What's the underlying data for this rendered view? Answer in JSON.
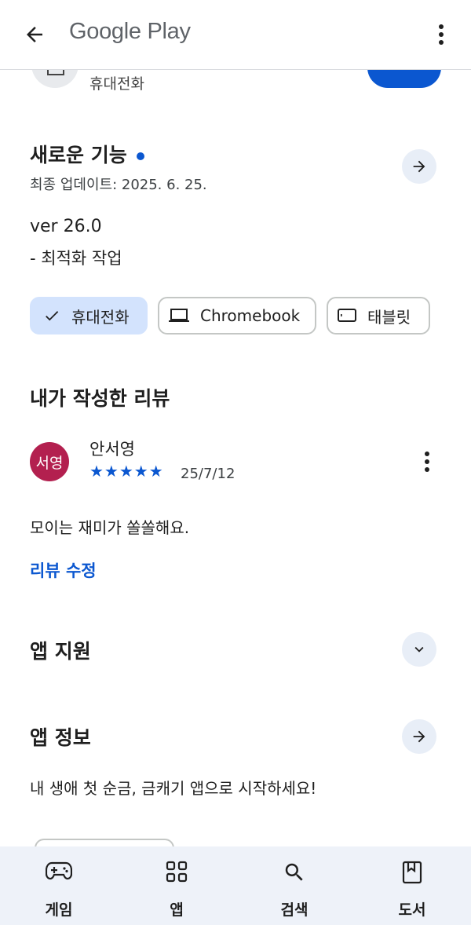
{
  "app_bar": {
    "title": "Google Play"
  },
  "device_row": {
    "label": "휴대전화"
  },
  "whats_new": {
    "title": "새로운 기능",
    "updated": "최종 업데이트: 2025. 6. 25.",
    "version": "ver 26.0",
    "changes": "- 최적화 작업"
  },
  "device_chips": [
    {
      "label": "휴대전화",
      "icon": "check-icon",
      "selected": true
    },
    {
      "label": "Chromebook",
      "icon": "laptop-icon",
      "selected": false
    },
    {
      "label": "태블릿",
      "icon": "tablet-icon",
      "selected": false
    }
  ],
  "my_review": {
    "title": "내가 작성한 리뷰",
    "avatar_text": "서영",
    "reviewer": "안서영",
    "stars": "★★★★★",
    "rating": 5,
    "date": "25/7/12",
    "text": "모이는 재미가 쏠쏠해요.",
    "edit_label": "리뷰 수정"
  },
  "app_support": {
    "title": "앱 지원"
  },
  "about": {
    "title": "앱 정보",
    "description": "내 생애 첫 순금, 금캐기 앱으로 시작하세요!"
  },
  "bottom_nav": [
    {
      "label": "게임",
      "icon": "gamepad-icon"
    },
    {
      "label": "앱",
      "icon": "apps-grid-icon"
    },
    {
      "label": "검색",
      "icon": "search-icon"
    },
    {
      "label": "도서",
      "icon": "book-icon"
    }
  ],
  "colors": {
    "accent": "#0b57d0",
    "chip_selected": "#d3e3fd",
    "avatar": "#b3204f",
    "nav_bg": "#eef2f9"
  }
}
